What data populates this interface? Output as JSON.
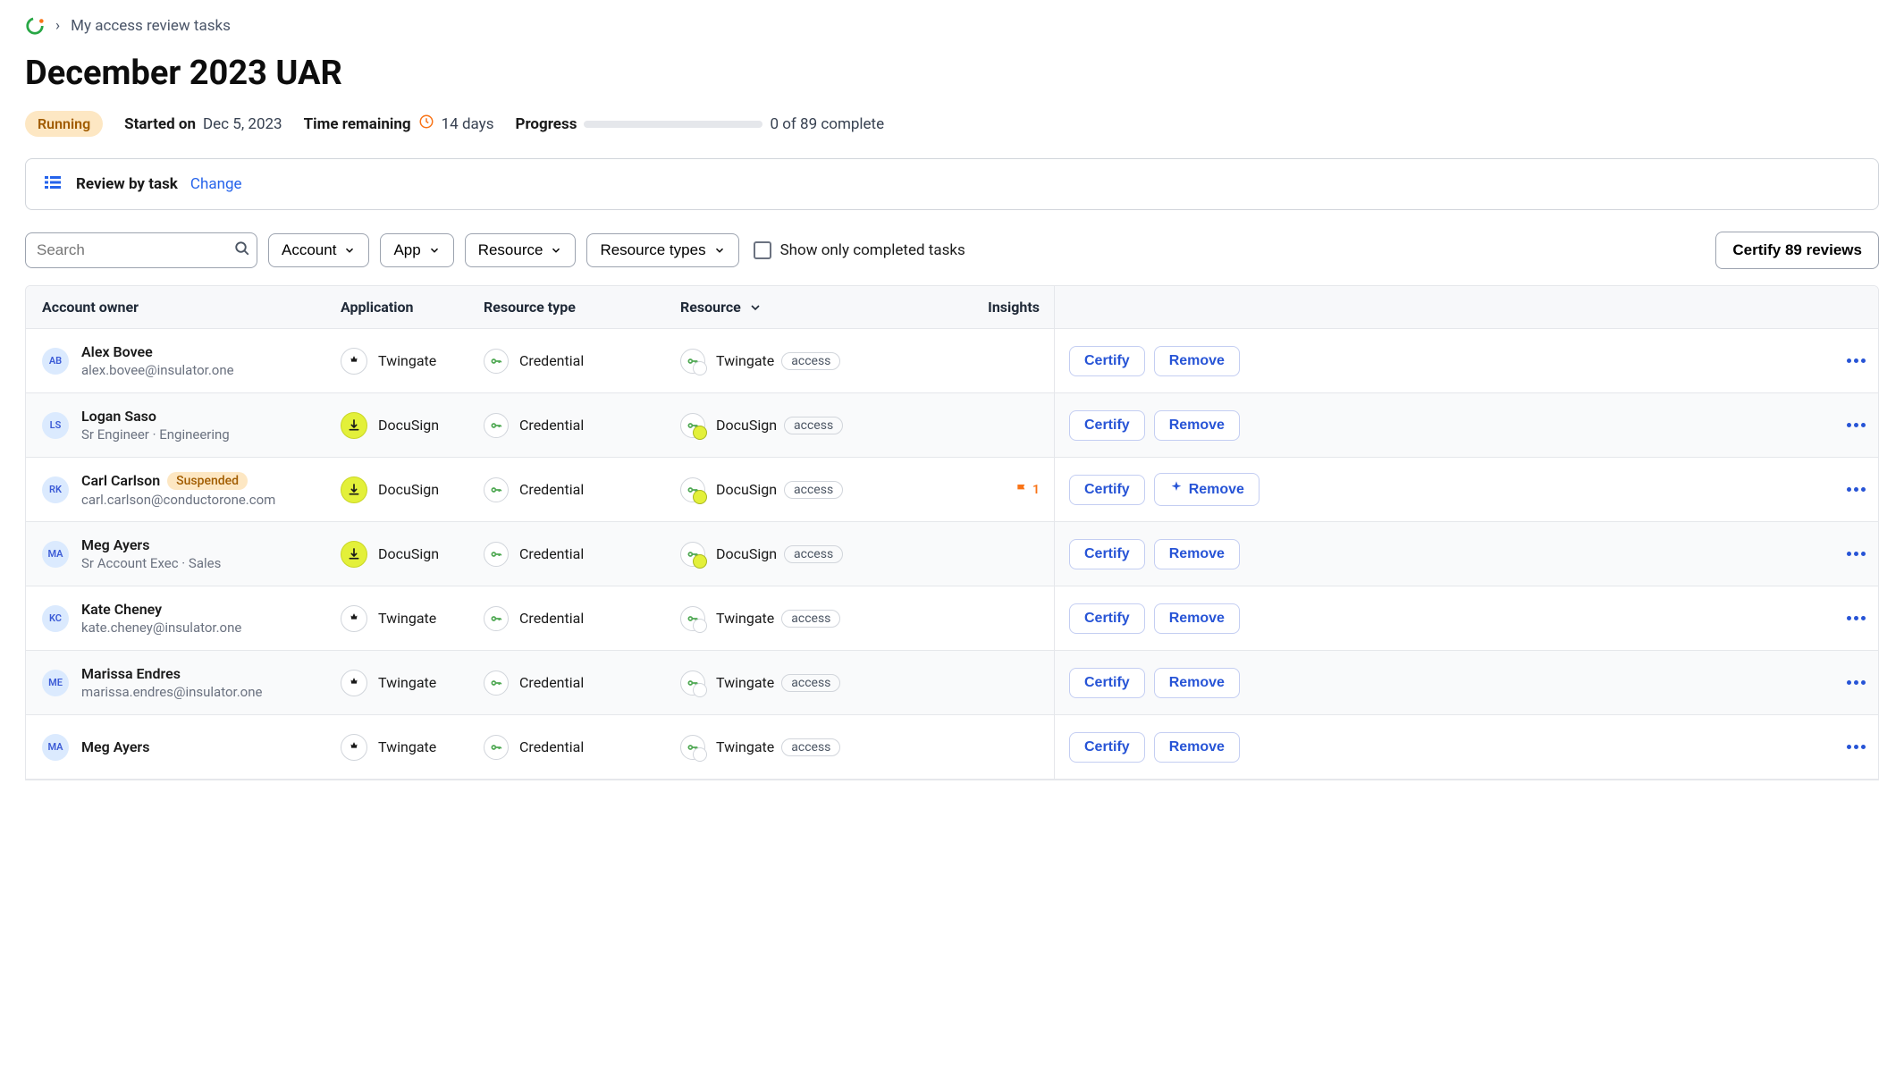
{
  "breadcrumb": {
    "current": "My access review tasks"
  },
  "page_title": "December 2023 UAR",
  "status": {
    "badge": "Running",
    "started_label": "Started on",
    "started_value": "Dec 5, 2023",
    "time_remaining_label": "Time remaining",
    "time_remaining_value": "14 days",
    "progress_label": "Progress",
    "progress_text": "0 of 89 complete"
  },
  "review_mode": {
    "label": "Review by task",
    "change": "Change"
  },
  "filters": {
    "search_placeholder": "Search",
    "account": "Account",
    "app": "App",
    "resource": "Resource",
    "resource_types": "Resource types",
    "show_completed": "Show only completed tasks"
  },
  "certify_all": "Certify 89 reviews",
  "columns": {
    "owner": "Account owner",
    "application": "Application",
    "resource_type": "Resource type",
    "resource": "Resource",
    "insights": "Insights"
  },
  "actions": {
    "certify": "Certify",
    "remove": "Remove"
  },
  "rows": [
    {
      "initials": "AB",
      "name": "Alex Bovee",
      "sub": "alex.bovee@insulator.one",
      "suspended": false,
      "app": "Twingate",
      "app_type": "twingate",
      "res_type": "Credential",
      "resource": "Twingate",
      "tag": "access",
      "insight_flag": 0,
      "remove_ai": false
    },
    {
      "initials": "LS",
      "name": "Logan Saso",
      "sub": "Sr Engineer · Engineering",
      "suspended": false,
      "app": "DocuSign",
      "app_type": "docusign",
      "res_type": "Credential",
      "resource": "DocuSign",
      "tag": "access",
      "insight_flag": 0,
      "remove_ai": false
    },
    {
      "initials": "RK",
      "name": "Carl Carlson",
      "sub": "carl.carlson@conductorone.com",
      "suspended": true,
      "suspended_label": "Suspended",
      "app": "DocuSign",
      "app_type": "docusign",
      "res_type": "Credential",
      "resource": "DocuSign",
      "tag": "access",
      "insight_flag": 1,
      "remove_ai": true
    },
    {
      "initials": "MA",
      "name": "Meg Ayers",
      "sub": "Sr Account Exec · Sales",
      "suspended": false,
      "app": "DocuSign",
      "app_type": "docusign",
      "res_type": "Credential",
      "resource": "DocuSign",
      "tag": "access",
      "insight_flag": 0,
      "remove_ai": false
    },
    {
      "initials": "KC",
      "name": "Kate Cheney",
      "sub": "kate.cheney@insulator.one",
      "suspended": false,
      "app": "Twingate",
      "app_type": "twingate",
      "res_type": "Credential",
      "resource": "Twingate",
      "tag": "access",
      "insight_flag": 0,
      "remove_ai": false
    },
    {
      "initials": "ME",
      "name": "Marissa Endres",
      "sub": "marissa.endres@insulator.one",
      "suspended": false,
      "app": "Twingate",
      "app_type": "twingate",
      "res_type": "Credential",
      "resource": "Twingate",
      "tag": "access",
      "insight_flag": 0,
      "remove_ai": false
    },
    {
      "initials": "MA",
      "name": "Meg Ayers",
      "sub": "",
      "suspended": false,
      "app": "Twingate",
      "app_type": "twingate",
      "res_type": "Credential",
      "resource": "Twingate",
      "tag": "access",
      "insight_flag": 0,
      "remove_ai": false
    }
  ]
}
